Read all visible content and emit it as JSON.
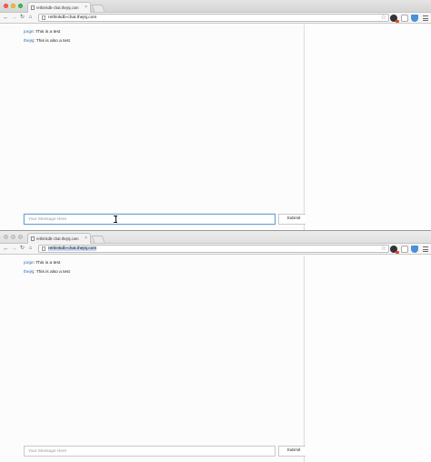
{
  "windows": [
    {
      "tab": {
        "title": "rethinkdb-chat.thejsj.com",
        "close": "×"
      },
      "address": {
        "url": "rethinkdb-chat.thejsj.com"
      },
      "messages": [
        {
          "user": "jorge",
          "text": " This is a test"
        },
        {
          "user": "thejsj",
          "text": " This is also a test"
        }
      ],
      "composer": {
        "placeholder": "Your Message Here",
        "submit_label": "Submit"
      }
    },
    {
      "tab": {
        "title": "rethinkdb-chat.thejsj.com",
        "close": "×"
      },
      "address": {
        "url": "rethinkdb-chat.thejsj.com"
      },
      "messages": [
        {
          "user": "jorge",
          "text": " This is a test"
        },
        {
          "user": "thejsj",
          "text": " This is also a test"
        }
      ],
      "composer": {
        "placeholder": "Your Message Here",
        "submit_label": "Submit"
      }
    }
  ],
  "icons": {
    "back": "←",
    "forward": "→",
    "reload": "↻",
    "home": "⌂",
    "star": "☆"
  },
  "colors": {
    "username_link": "#2a6db5",
    "focus_border": "#6aa0d8"
  }
}
